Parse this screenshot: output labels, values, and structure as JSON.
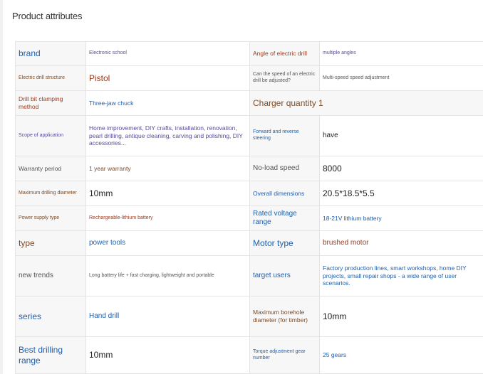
{
  "page": {
    "title": "Product attributes"
  },
  "rows": [
    {
      "k1": "brand",
      "v1": "Electronic school",
      "k2": "Angle of electric drill",
      "v2": "multiple angles"
    },
    {
      "k1": "Electric drill structure",
      "v1": "Pistol",
      "k2": "Can the speed of an electric drill be adjusted?",
      "v2": "Multi-speed speed adjustment"
    },
    {
      "k1": "Drill bit clamping method",
      "v1": "Three-jaw chuck",
      "k2": "Charger quantity 1",
      "v2": ""
    },
    {
      "k1": "Scope of application",
      "v1": "Home improvement, DIY crafts, installation, renovation, pearl drilling, antique cleaning, carving and polishing, DIY accessories...",
      "k2": "Forward and reverse steering",
      "v2": "have"
    },
    {
      "k1": "Warranty period",
      "v1": "1 year warranty",
      "k2": "No-load speed",
      "v2": "8000"
    },
    {
      "k1": "Maximum drilling diameter",
      "v1": "10mm",
      "k2": "Overall dimensions",
      "v2": "20.5*18.5*5.5"
    },
    {
      "k1": "Power supply type",
      "v1": "Rechargeable-lithium battery",
      "k2": "Rated voltage range",
      "v2": "18-21V lithium battery"
    },
    {
      "k1": "type",
      "v1": "power tools",
      "k2": "Motor type",
      "v2": "brushed motor"
    },
    {
      "k1": "new trends",
      "v1": "Long battery life + fast charging, lightweight and portable",
      "k2": "target users",
      "v2": "Factory production lines, smart workshops, home DIY projects, small repair shops - a wide range of user scenarios."
    },
    {
      "k1": "series",
      "v1": "Hand drill",
      "k2": "Maximum borehole diameter (for timber)",
      "v2": "10mm"
    },
    {
      "k1": "Best drilling range",
      "v1": "10mm",
      "k2": "Torque adjustment gear number",
      "v2": "25 gears"
    }
  ]
}
